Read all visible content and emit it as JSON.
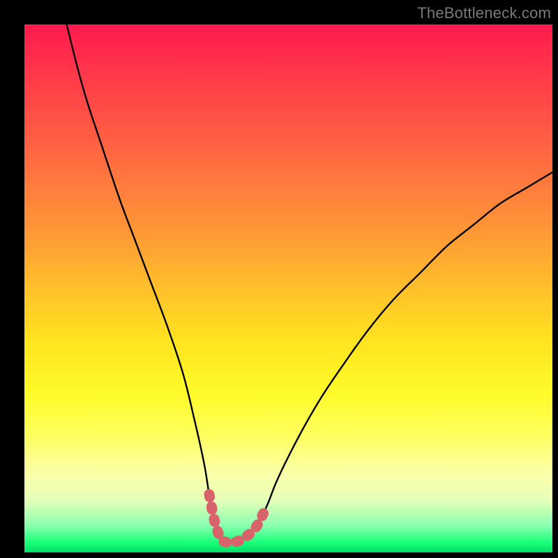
{
  "watermark": {
    "text": "TheBottleneck.com"
  },
  "colors": {
    "background": "#000000",
    "curve": "#000000",
    "highlight": "#d9636b"
  },
  "chart_data": {
    "type": "line",
    "title": "",
    "xlabel": "",
    "ylabel": "",
    "xlim": [
      0,
      100
    ],
    "ylim": [
      0,
      100
    ],
    "grid": false,
    "series": [
      {
        "name": "bottleneck-curve",
        "x": [
          8,
          10,
          12,
          15,
          18,
          21,
          24,
          27,
          30,
          32,
          34,
          35,
          36,
          37,
          38,
          40,
          42,
          44,
          46,
          48,
          52,
          56,
          60,
          65,
          70,
          75,
          80,
          85,
          90,
          95,
          100
        ],
        "values": [
          100,
          92,
          85,
          76,
          67,
          59,
          51,
          43,
          34,
          26,
          17,
          11,
          6,
          3,
          2,
          2,
          3,
          5,
          9,
          14,
          22,
          29,
          35,
          42,
          48,
          53,
          58,
          62,
          66,
          69,
          72
        ]
      }
    ],
    "highlight_region": {
      "name": "optimal-zone",
      "index_start": 11,
      "index_end": 18,
      "x": [
        35,
        36,
        37,
        38,
        40,
        42,
        44,
        46
      ],
      "values": [
        11,
        6,
        3,
        2,
        2,
        3,
        5,
        9
      ]
    }
  }
}
